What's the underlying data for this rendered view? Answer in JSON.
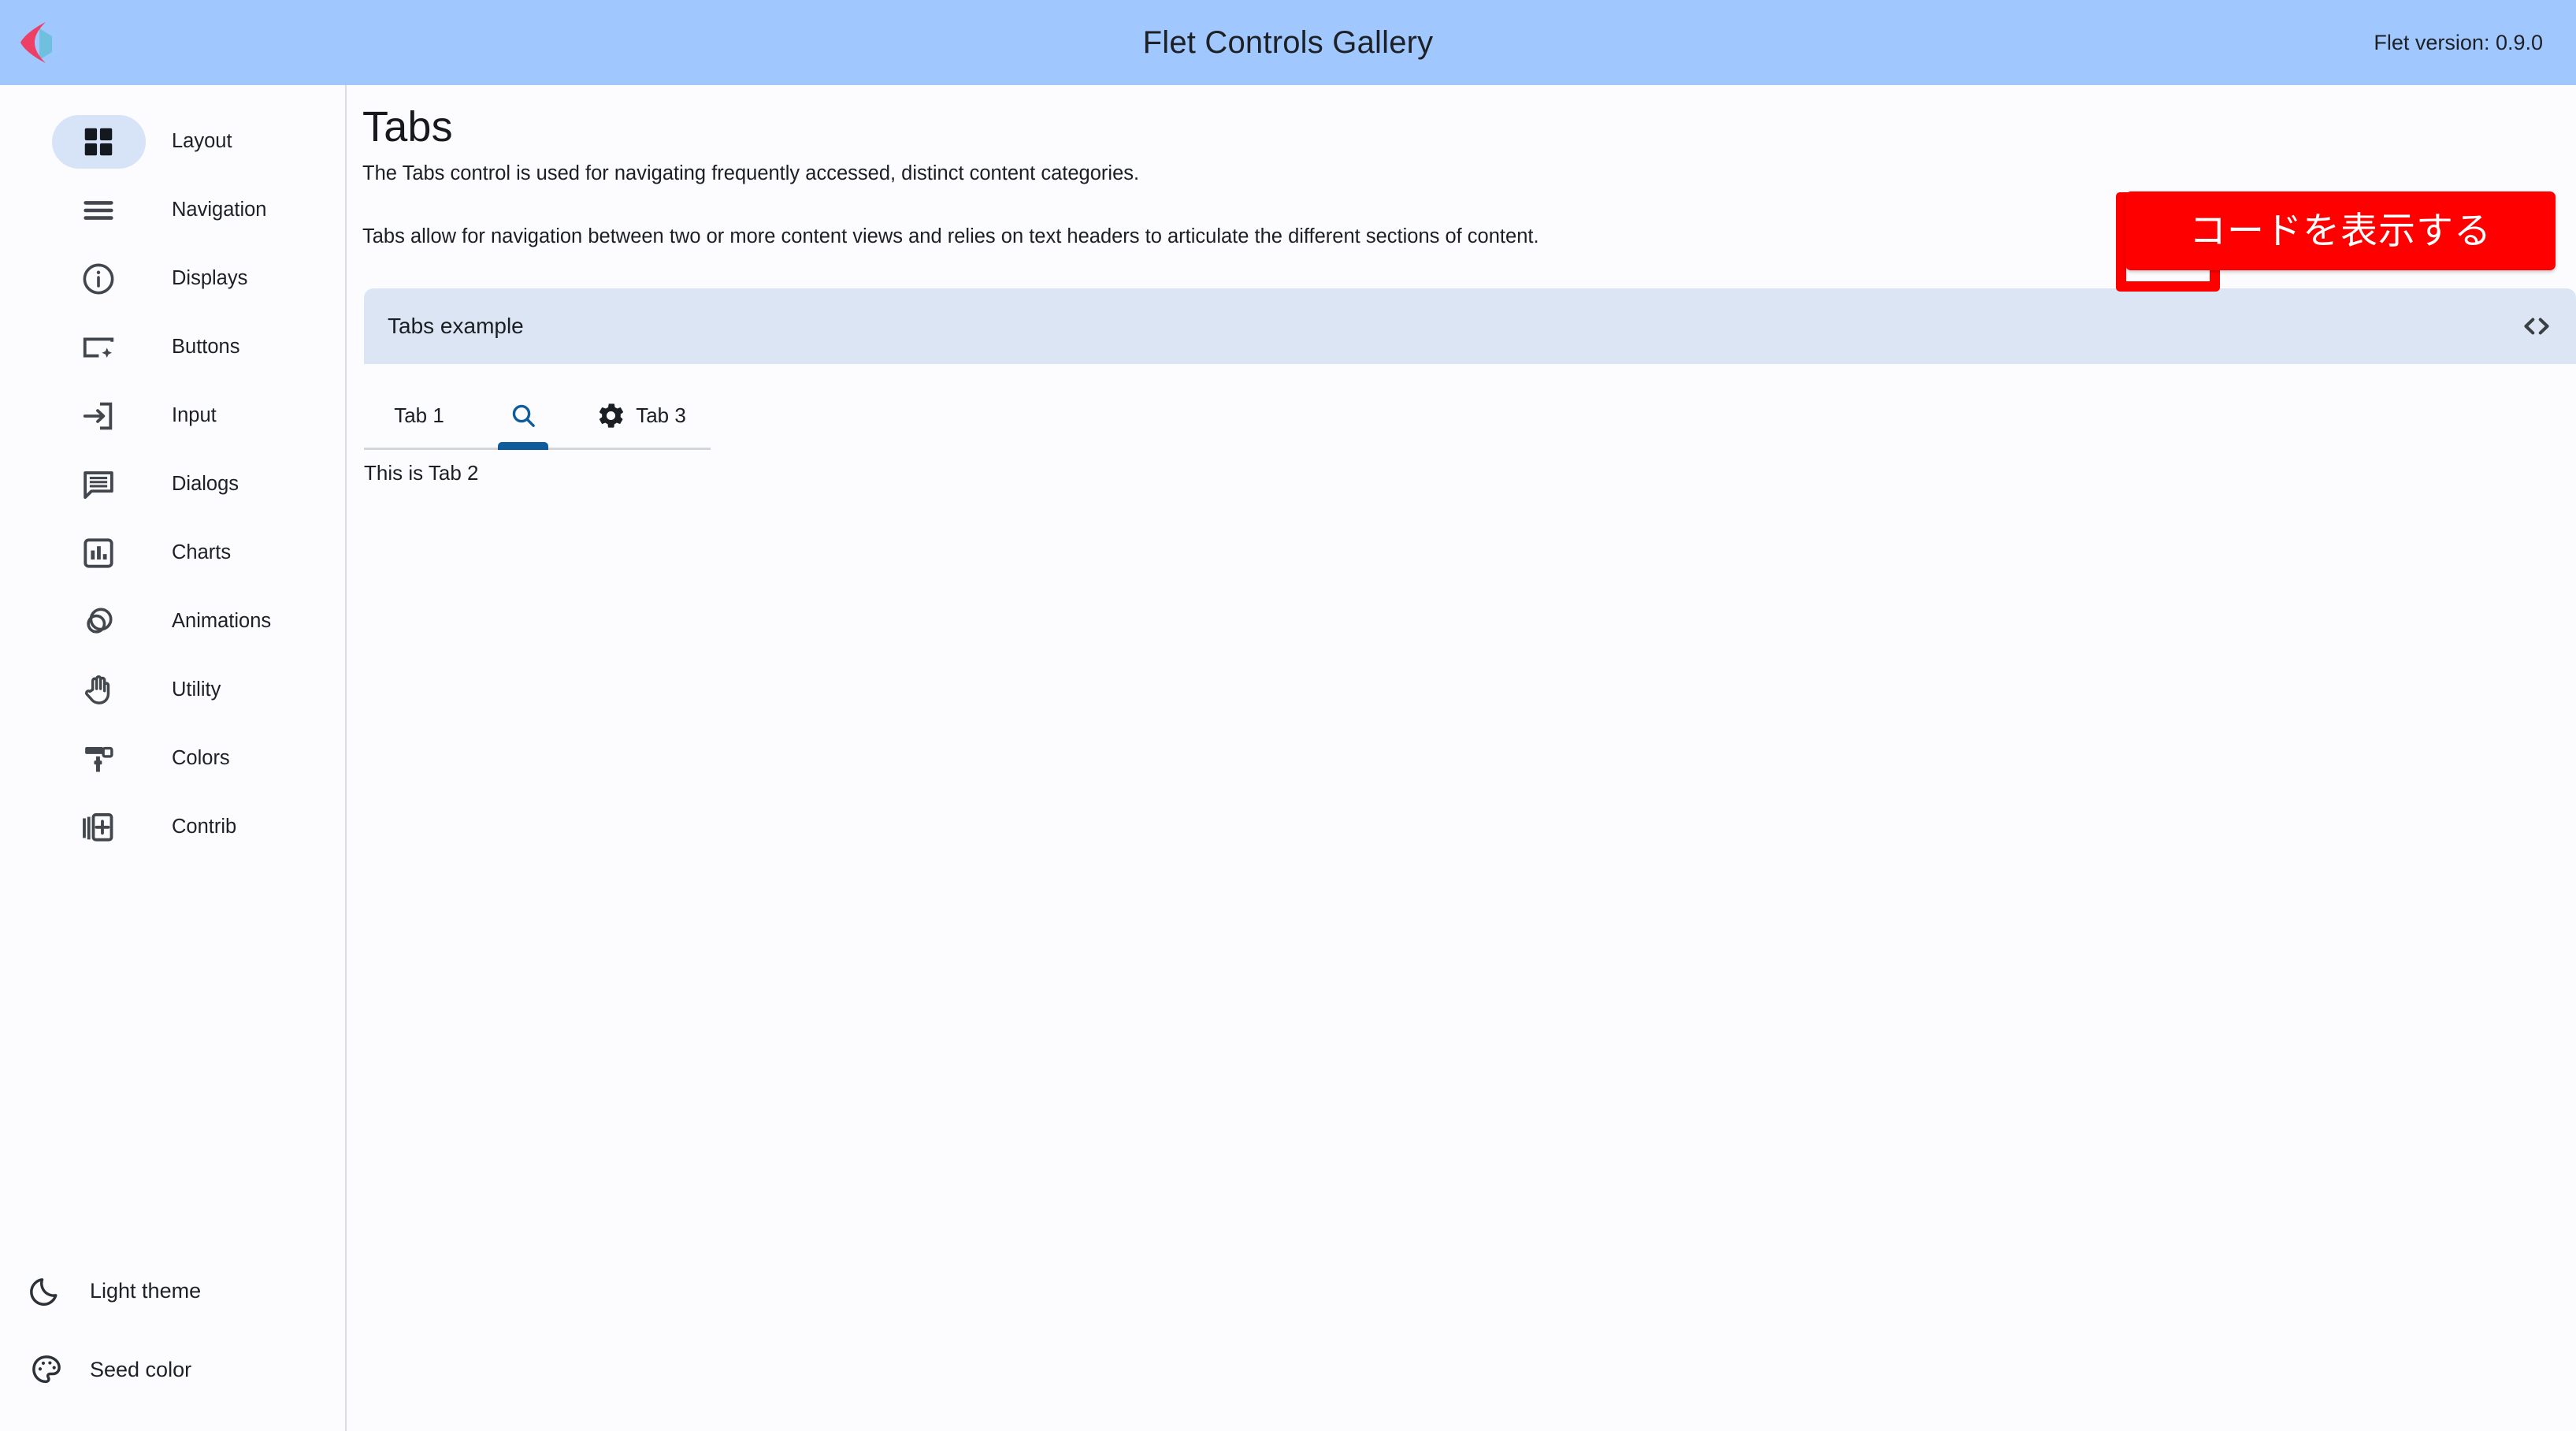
{
  "appbar": {
    "title": "Flet Controls Gallery",
    "version": "Flet version: 0.9.0",
    "logo_icon": "flet-logo-icon",
    "background": "#A0C8FE"
  },
  "sidebar": {
    "items": [
      {
        "label": "Layout",
        "icon": "grid-view-icon",
        "selected": true
      },
      {
        "label": "Navigation",
        "icon": "menu-icon",
        "selected": false
      },
      {
        "label": "Displays",
        "icon": "info-circle-icon",
        "selected": false
      },
      {
        "label": "Buttons",
        "icon": "smart-button-icon",
        "selected": false
      },
      {
        "label": "Input",
        "icon": "input-icon",
        "selected": false
      },
      {
        "label": "Dialogs",
        "icon": "chat-box-icon",
        "selected": false
      },
      {
        "label": "Charts",
        "icon": "bar-chart-icon",
        "selected": false
      },
      {
        "label": "Animations",
        "icon": "animation-icon",
        "selected": false
      },
      {
        "label": "Utility",
        "icon": "hand-icon",
        "selected": false
      },
      {
        "label": "Colors",
        "icon": "paint-roller-icon",
        "selected": false
      },
      {
        "label": "Contrib",
        "icon": "library-add-icon",
        "selected": false
      }
    ],
    "actions": [
      {
        "label": "Light theme",
        "icon": "moon-icon"
      },
      {
        "label": "Seed color",
        "icon": "palette-icon"
      }
    ],
    "selected_pill_color": "#D7E3F7"
  },
  "main": {
    "title": "Tabs",
    "description_1": "The Tabs control is used for navigating frequently accessed, distinct content categories.",
    "description_2": "Tabs allow for navigation between two or more content views and relies on text headers to articulate the different sections of content.",
    "example": {
      "title": "Tabs example",
      "code_button_icon": "code-brackets-icon",
      "bar_color": "#DCE5F4"
    },
    "tabs": [
      {
        "label": "Tab 1",
        "icon": null,
        "selected": false
      },
      {
        "label": "",
        "icon": "search-icon",
        "selected": true
      },
      {
        "label": "Tab 3",
        "icon": "gear-icon",
        "selected": false
      }
    ],
    "tab_panel_text": "This is Tab 2",
    "selected_tab_color": "#0F5C9C"
  },
  "annotation": {
    "text": "コードを表示する",
    "background": "#FF0000",
    "text_color": "#FFFFFF",
    "highlight_border_color": "#FF0000"
  }
}
